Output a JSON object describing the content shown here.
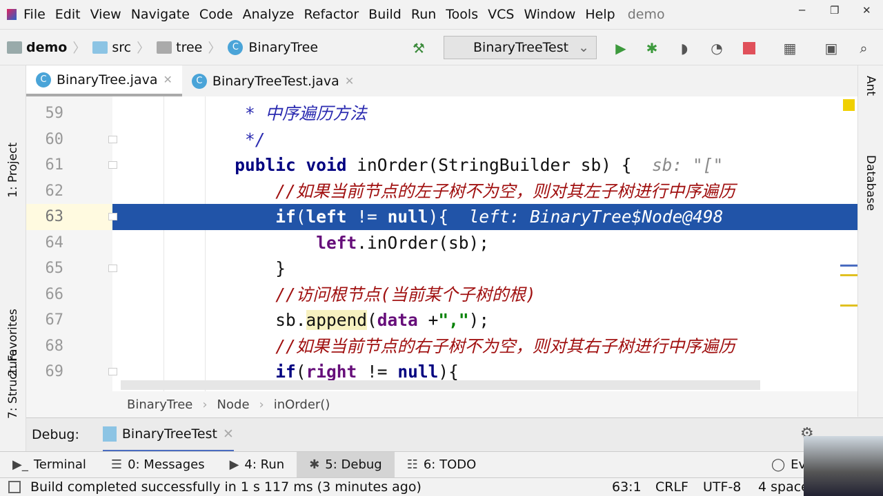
{
  "menubar": {
    "items": [
      "File",
      "Edit",
      "View",
      "Navigate",
      "Code",
      "Analyze",
      "Refactor",
      "Build",
      "Run",
      "Tools",
      "VCS",
      "Window",
      "Help"
    ],
    "project": "demo"
  },
  "breadcrumb": [
    "demo",
    "src",
    "tree",
    "BinaryTree"
  ],
  "run_config": "BinaryTreeTest",
  "tabs": [
    {
      "label": "BinaryTree.java"
    },
    {
      "label": "BinaryTreeTest.java"
    }
  ],
  "left_tools": [
    "1: Project",
    "2: Favorites",
    "7: Structure"
  ],
  "right_tools": [
    "Ant",
    "Database"
  ],
  "code": [
    {
      "n": "59",
      "fold": false,
      "tokens": [
        [
          "doc",
          "            * 中序遍历方法"
        ]
      ]
    },
    {
      "n": "60",
      "fold": true,
      "tokens": [
        [
          "doc",
          "            */"
        ]
      ]
    },
    {
      "n": "61",
      "fold": true,
      "tokens": [
        [
          "kw",
          "           public void "
        ],
        [
          "",
          "inOrder(StringBuilder sb) {  "
        ],
        [
          "hint",
          "sb: \"[\""
        ]
      ]
    },
    {
      "n": "62",
      "fold": false,
      "tokens": [
        [
          "cm",
          "               //如果当前节点的左子树不为空，则对其左子树进行中序遍历"
        ]
      ]
    },
    {
      "n": "63",
      "fold": true,
      "current": true,
      "tokens": [
        [
          "kw",
          "               if"
        ],
        [
          "",
          "("
        ],
        [
          "fld",
          "left"
        ],
        [
          "",
          " != "
        ],
        [
          "kw",
          "null"
        ],
        [
          "",
          "){  "
        ],
        [
          "hint",
          "left: BinaryTree$Node@498"
        ]
      ]
    },
    {
      "n": "64",
      "fold": false,
      "tokens": [
        [
          "fld",
          "                   left"
        ],
        [
          "",
          ".inOrder(sb);"
        ]
      ]
    },
    {
      "n": "65",
      "fold": true,
      "tokens": [
        [
          "",
          "               }"
        ]
      ]
    },
    {
      "n": "66",
      "fold": false,
      "tokens": [
        [
          "cm",
          "               //访问根节点(当前某个子树的根)"
        ]
      ]
    },
    {
      "n": "67",
      "fold": false,
      "tokens": [
        [
          "",
          "               sb."
        ],
        [
          "mth",
          "append"
        ],
        [
          "",
          "("
        ],
        [
          "fld",
          "data"
        ],
        [
          "",
          " +"
        ],
        [
          "str",
          "\",\""
        ],
        [
          "",
          ");"
        ]
      ]
    },
    {
      "n": "68",
      "fold": false,
      "tokens": [
        [
          "cm",
          "               //如果当前节点的右子树不为空，则对其右子树进行中序遍历"
        ]
      ]
    },
    {
      "n": "69",
      "fold": true,
      "tokens": [
        [
          "kw",
          "               if"
        ],
        [
          "",
          "("
        ],
        [
          "fld",
          "right"
        ],
        [
          "",
          " != "
        ],
        [
          "kw",
          "null"
        ],
        [
          "",
          "){"
        ]
      ]
    }
  ],
  "navbar": [
    "BinaryTree",
    "Node",
    "inOrder()"
  ],
  "debug": {
    "label": "Debug:",
    "session": "BinaryTreeTest"
  },
  "tool_tabs": [
    {
      "label": "Terminal",
      "icon": "terminal-icon"
    },
    {
      "label": "0: Messages",
      "icon": "messages-icon"
    },
    {
      "label": "4: Run",
      "icon": "run-icon"
    },
    {
      "label": "5: Debug",
      "icon": "debug-icon",
      "active": true
    },
    {
      "label": "6: TODO",
      "icon": "todo-icon"
    },
    {
      "label": "Eve",
      "icon": "event-log-icon"
    }
  ],
  "status": {
    "message": "Build completed successfully in 1 s 117 ms (3 minutes ago)",
    "position": "63:1",
    "line_sep": "CRLF",
    "encoding": "UTF-8",
    "indent": "4 space"
  },
  "colors": {
    "current_line": "#2154a8",
    "keyword": "#000080",
    "field": "#660e7a",
    "string": "#008000",
    "comment": "#a01010"
  }
}
